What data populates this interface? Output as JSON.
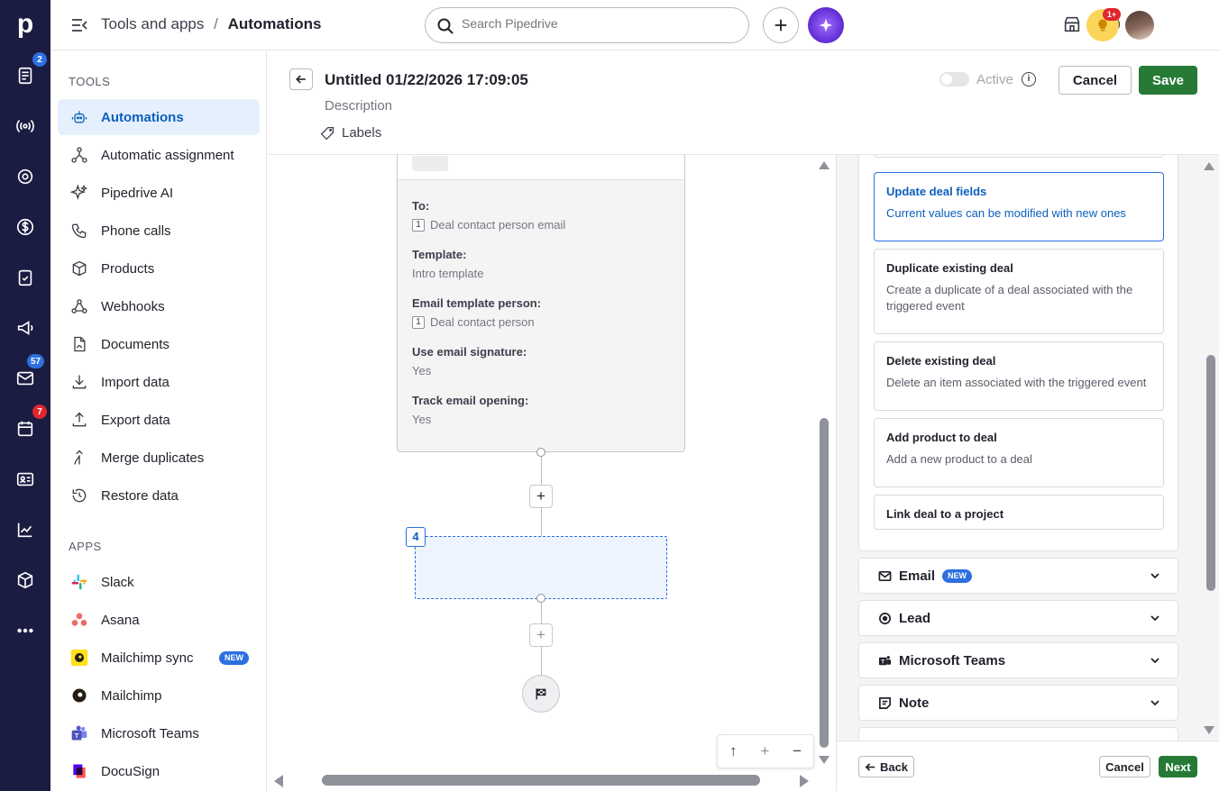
{
  "app": {
    "logo": "p",
    "breadcrumb": {
      "parent": "Tools and apps",
      "separator": "/",
      "current": "Automations"
    },
    "search_placeholder": "Search Pipedrive",
    "notification_badge": "1+"
  },
  "rail": {
    "badges": {
      "leads": "2",
      "mail": "57",
      "activities": "7"
    },
    "badge_colors": {
      "blue": "#2d6fdf",
      "red": "#e0262e"
    }
  },
  "sidebar": {
    "tools_title": "TOOLS",
    "tools": [
      {
        "label": "Automations",
        "icon": "robot-icon",
        "active": true
      },
      {
        "label": "Automatic assignment",
        "icon": "assignment-icon"
      },
      {
        "label": "Pipedrive AI",
        "icon": "sparkle-icon"
      },
      {
        "label": "Phone calls",
        "icon": "phone-icon"
      },
      {
        "label": "Products",
        "icon": "box-icon"
      },
      {
        "label": "Webhooks",
        "icon": "webhook-icon"
      },
      {
        "label": "Documents",
        "icon": "document-icon"
      },
      {
        "label": "Import data",
        "icon": "download-icon"
      },
      {
        "label": "Export data",
        "icon": "upload-icon"
      },
      {
        "label": "Merge duplicates",
        "icon": "merge-icon"
      },
      {
        "label": "Restore data",
        "icon": "restore-icon"
      }
    ],
    "apps_title": "APPS",
    "apps": [
      {
        "label": "Slack",
        "icon": "slack-icon"
      },
      {
        "label": "Asana",
        "icon": "asana-icon"
      },
      {
        "label": "Mailchimp sync",
        "icon": "mailchimp-icon",
        "badge": "NEW"
      },
      {
        "label": "Mailchimp",
        "icon": "mailchimp-icon"
      },
      {
        "label": "Microsoft Teams",
        "icon": "teams-icon"
      },
      {
        "label": "DocuSign",
        "icon": "docusign-icon"
      }
    ]
  },
  "editor": {
    "title": "Untitled 01/22/2026 17:09:05",
    "description_placeholder": "Description",
    "labels": "Labels",
    "active_label": "Active",
    "active": false,
    "cancel_label": "Cancel",
    "save_label": "Save",
    "accent_green": "#267a35"
  },
  "email_node": {
    "to_label": "To:",
    "to_num": "1",
    "to_value": "Deal contact person email",
    "template_label": "Template:",
    "template_value": "Intro template",
    "template_person_label": "Email template person:",
    "template_person_num": "1",
    "template_person_value": "Deal contact person",
    "signature_label": "Use email signature:",
    "signature_value": "Yes",
    "tracking_label": "Track email opening:",
    "tracking_value": "Yes"
  },
  "placeholder_step": {
    "number": "4"
  },
  "zoom": {
    "up": "↑",
    "plus": "+",
    "minus": "−"
  },
  "actions_panel": {
    "cards": [
      {
        "title": "Update deal fields",
        "desc": "Current values can be modified with new ones",
        "selected": true
      },
      {
        "title": "Duplicate existing deal",
        "desc": "Create a duplicate of a deal associated with the triggered event"
      },
      {
        "title": "Delete existing deal",
        "desc": "Delete an item associated with the triggered event"
      },
      {
        "title": "Add product to deal",
        "desc": "Add a new product to a deal"
      },
      {
        "title": "Link deal to a project",
        "desc": ""
      }
    ],
    "groups": [
      {
        "label": "Email",
        "icon": "mail-icon",
        "badge": "NEW"
      },
      {
        "label": "Lead",
        "icon": "target-icon"
      },
      {
        "label": "Microsoft Teams",
        "icon": "teams-icon"
      },
      {
        "label": "Note",
        "icon": "note-icon"
      }
    ],
    "back_label": "Back",
    "cancel_label": "Cancel",
    "next_label": "Next"
  }
}
